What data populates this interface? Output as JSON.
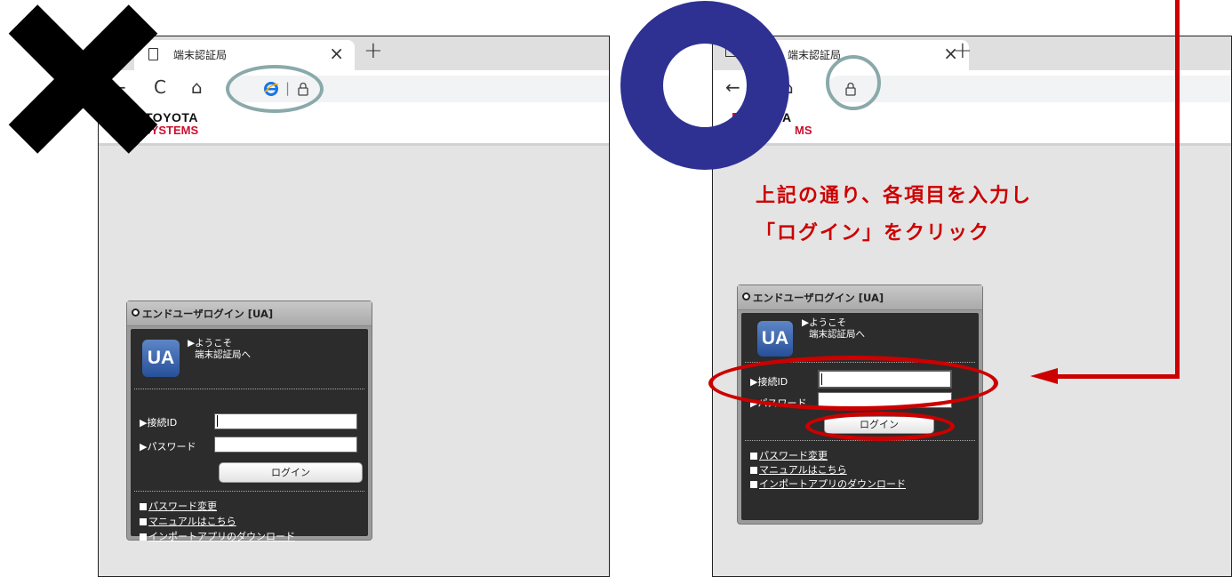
{
  "browser": {
    "tab_title": "端末認証局",
    "tab_close": "×",
    "new_tab": "+",
    "back": "←",
    "reload": "C",
    "home": "⌂"
  },
  "brand": {
    "line1": "TOYOTA",
    "line2": "SYSTEMS",
    "line1_partial": "TA",
    "line2_partial": "MS"
  },
  "login": {
    "header": "エンドユーザログイン [UA]",
    "logo": "UA",
    "welcome_line1": "▶ようこそ",
    "welcome_line2": "端末認証局へ",
    "id_label": "▶接続ID",
    "password_label": "▶パスワード",
    "login_button": "ログイン",
    "links": [
      "パスワード変更",
      "マニュアルはこちら",
      "インポートアプリのダウンロード"
    ]
  },
  "instruction": {
    "line1": "上記の通り、各項目を入力し",
    "line2": "「ログイン」をクリック"
  },
  "colors": {
    "accent_red": "#cc0000",
    "circle_blue": "#2e3192",
    "highlight_teal": "#8aa9aa"
  }
}
